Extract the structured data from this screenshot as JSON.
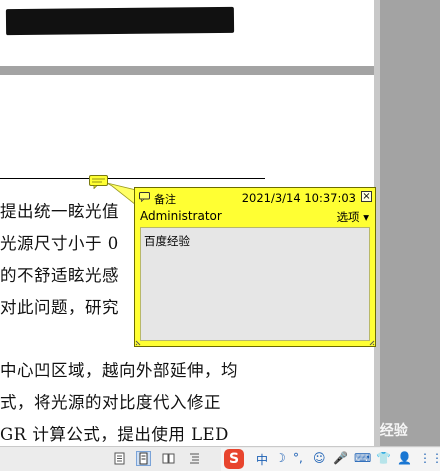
{
  "document": {
    "lines": [
      "提出统一眩光值",
      "光源尺寸小于 0",
      "的不舒适眩光感",
      "对此问题，研究",
      "中心凹区域，越向外部延伸，均",
      "式，将光源的对比度代入修正",
      "GR 计算公式，提出使用 LED"
    ]
  },
  "comment_popup": {
    "type_label": "备注",
    "datetime": "2021/3/14 10:37:03",
    "close_glyph": "×",
    "author": "Administrator",
    "options_label": "选项 ▾",
    "content": "百度经验"
  },
  "statusbar": {
    "view_buttons": [
      "normal-view",
      "single-page-view",
      "two-page-view",
      "outline-view"
    ]
  },
  "ime": {
    "logo": "S",
    "items": [
      "中",
      "☽",
      "°,",
      "☺",
      "🎤",
      "⌨",
      "👕",
      "👤",
      "⋮⋮"
    ]
  },
  "watermark": "Baidu 经验",
  "colors": {
    "note_yellow": "#ffff33",
    "note_border": "#6b6b00",
    "ime_red": "#e8452e"
  }
}
